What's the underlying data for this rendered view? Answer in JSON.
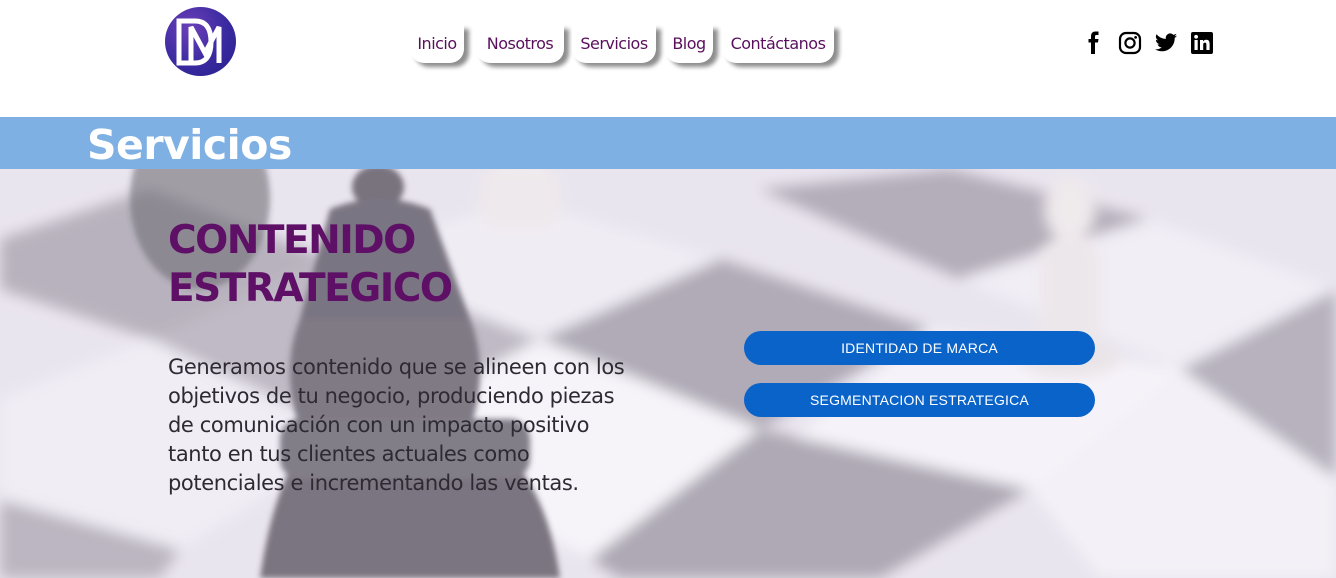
{
  "logo": {
    "alt": "DM"
  },
  "nav": {
    "items": [
      {
        "label": "Inicio"
      },
      {
        "label": "Nosotros"
      },
      {
        "label": "Servicios"
      },
      {
        "label": "Blog"
      },
      {
        "label": "Contáctanos"
      }
    ]
  },
  "social": [
    "facebook-icon",
    "instagram-icon",
    "twitter-icon",
    "linkedin-icon"
  ],
  "banner": {
    "title": "Servicios"
  },
  "section": {
    "heading_line1": "CONTENIDO",
    "heading_line2": "ESTRATEGICO",
    "description": "Generamos contenido que se alineen con los objetivos de tu negocio, produciendo piezas de comunicación con un impacto positivo tanto en tus clientes actuales como potenciales e incrementando las ventas.",
    "buttons": [
      {
        "label": "IDENTIDAD DE MARCA"
      },
      {
        "label": "SEGMENTACION ESTRATEGICA"
      }
    ]
  },
  "colors": {
    "brand_purple": "#5e0f66",
    "banner_blue": "#7fb0e3",
    "button_blue": "#0a63c9"
  }
}
